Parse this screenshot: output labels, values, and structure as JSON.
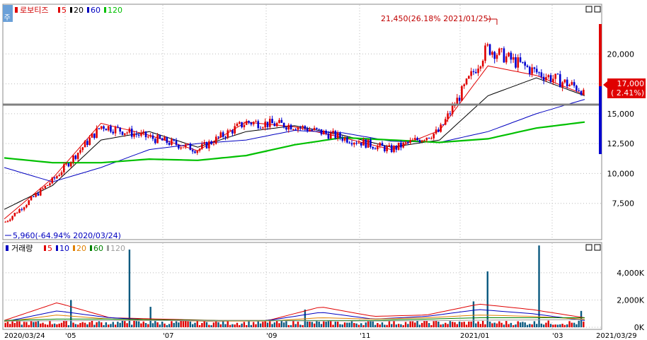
{
  "price_panel": {
    "icon_label": "주",
    "stock_name": "로보티즈",
    "ma_legend": [
      {
        "label": "5",
        "color": "#e00000"
      },
      {
        "label": "20",
        "color": "#000000"
      },
      {
        "label": "60",
        "color": "#0000c0"
      },
      {
        "label": "120",
        "color": "#00c000"
      }
    ],
    "high_annotation": "21,450(26.18% 2021/01/25)",
    "low_annotation": "5,960(-64.94% 2020/03/24)",
    "current_price": "17,000",
    "current_change": "( 2.41%)",
    "y_ticks": [
      "20,000",
      "17,500",
      "15,000",
      "12,500",
      "10,000",
      "7,500"
    ]
  },
  "volume_panel": {
    "title": "거래량",
    "ma_legend": [
      {
        "label": "5",
        "color": "#e00000"
      },
      {
        "label": "10",
        "color": "#0000c0"
      },
      {
        "label": "20",
        "color": "#e08000"
      },
      {
        "label": "60",
        "color": "#008000"
      },
      {
        "label": "120",
        "color": "#a0a0a0"
      }
    ],
    "y_ticks": [
      "4,000K",
      "2,000K",
      "0K"
    ]
  },
  "x_axis": {
    "labels": [
      "2020/03/24",
      "'05",
      "'07",
      "'09",
      "'11",
      "2021/01",
      "'03",
      "2021/03/29"
    ]
  },
  "colors": {
    "up": "#e00000",
    "down": "#0000d0",
    "support_line": "#808080"
  },
  "chart_data": [
    {
      "type": "candlestick",
      "title": "로보티즈",
      "ylim": [
        5000,
        22500
      ],
      "x": [
        "2020/03/24",
        "2020/04",
        "2020/05",
        "2020/06",
        "2020/07",
        "2020/08",
        "2020/09",
        "2020/10",
        "2020/11",
        "2020/12",
        "2021/01",
        "2021/02",
        "2021/03/29"
      ],
      "close": [
        5960,
        9500,
        14000,
        13000,
        12000,
        14300,
        14000,
        13000,
        12000,
        13500,
        20500,
        18500,
        17000
      ],
      "high_marker": {
        "value": 21450,
        "date": "2021/01/25"
      },
      "low_marker": {
        "value": 5960,
        "date": "2020/03/24"
      },
      "horizontal_line": 15500,
      "series": [
        {
          "name": "5",
          "values": [
            6200,
            9600,
            14200,
            13200,
            11900,
            14300,
            13900,
            13000,
            12000,
            13600,
            19000,
            18200,
            16600
          ]
        },
        {
          "name": "20",
          "values": [
            7000,
            9000,
            12800,
            13500,
            12200,
            13500,
            14000,
            13200,
            12200,
            12800,
            16500,
            18000,
            16500
          ]
        },
        {
          "name": "60",
          "values": [
            10500,
            9300,
            10500,
            12000,
            12500,
            12800,
            13600,
            13400,
            12700,
            12600,
            13500,
            15000,
            16200
          ]
        },
        {
          "name": "120",
          "values": [
            11300,
            10900,
            10900,
            11200,
            11100,
            11500,
            12400,
            13000,
            12800,
            12600,
            12900,
            13800,
            14300
          ]
        }
      ]
    },
    {
      "type": "bar",
      "title": "거래량",
      "ylim": [
        0,
        5600
      ],
      "x": [
        "2020/04",
        "2020/05",
        "2020/06",
        "2020/09",
        "2020/12",
        "2020/12",
        "2021/01",
        "2021/03"
      ],
      "values": [
        2000,
        5700,
        1500,
        1300,
        1900,
        4100,
        6000,
        1200
      ]
    }
  ]
}
